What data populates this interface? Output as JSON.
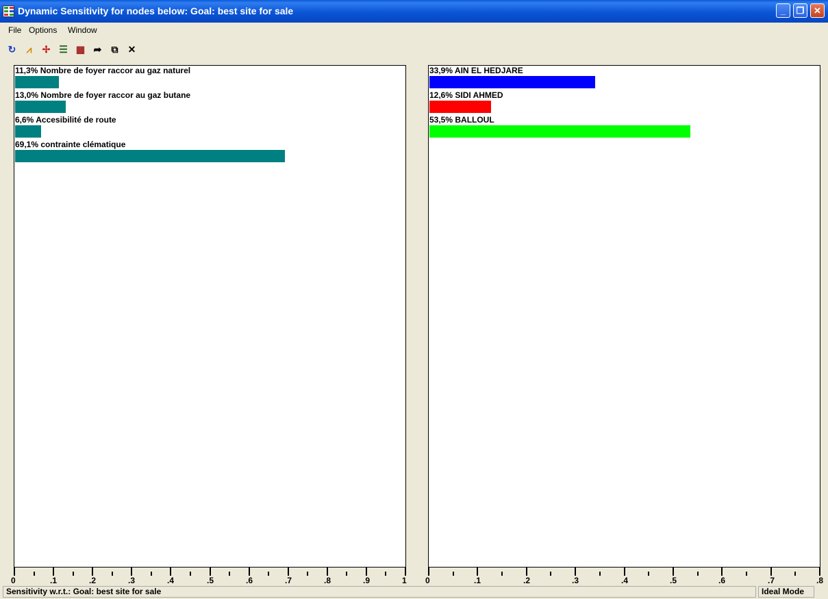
{
  "window": {
    "title": "Dynamic Sensitivity for nodes below: Goal: best site for sale",
    "minimize": "_",
    "maximize": "❐",
    "close": "✕"
  },
  "menu": [
    "File",
    "Options",
    "Window"
  ],
  "toolbar": [
    {
      "icon": "refresh-icon",
      "glyph": "↻",
      "color": "#1a3cc8"
    },
    {
      "icon": "performance-graph-icon",
      "glyph": "⩘",
      "color": "#d08a00"
    },
    {
      "icon": "gradient-icon",
      "glyph": "✢",
      "color": "#c02020"
    },
    {
      "icon": "head-to-head-icon",
      "glyph": "☰",
      "color": "#206020"
    },
    {
      "icon": "two-d-icon",
      "glyph": "▦",
      "color": "#a02020"
    },
    {
      "icon": "redo-arrow-icon",
      "glyph": "➦",
      "color": "#000000"
    },
    {
      "icon": "window-icon",
      "glyph": "⧉",
      "color": "#000000"
    },
    {
      "icon": "close-x-icon",
      "glyph": "✕",
      "color": "#000000"
    }
  ],
  "left_panel": {
    "items": [
      {
        "label": "11,3% Nombre de foyer raccor au gaz naturel",
        "value": 0.113
      },
      {
        "label": "13,0% Nombre de foyer raccor au gaz butane",
        "value": 0.13
      },
      {
        "label": "6,6% Accesibilité de route",
        "value": 0.066
      },
      {
        "label": "69,1% contrainte clématique",
        "value": 0.691
      }
    ],
    "bar_color": "#008080",
    "axis_max": 1,
    "tick_labels": [
      "0",
      ".1",
      ".2",
      ".3",
      ".4",
      ".5",
      ".6",
      ".7",
      ".8",
      ".9",
      "1"
    ]
  },
  "right_panel": {
    "items": [
      {
        "label": "33,9% AIN EL HEDJARE",
        "value": 0.339,
        "color": "#0000ff"
      },
      {
        "label": "12,6% SIDI AHMED",
        "value": 0.126,
        "color": "#ff0000"
      },
      {
        "label": "53,5% BALLOUL",
        "value": 0.535,
        "color": "#00ff00"
      }
    ],
    "axis_max": 0.8,
    "tick_labels": [
      "0",
      ".1",
      ".2",
      ".3",
      ".4",
      ".5",
      ".6",
      ".7",
      ".8"
    ]
  },
  "status": {
    "left": "Sensitivity w.r.t.: Goal: best site for sale",
    "right": "Ideal Mode"
  }
}
